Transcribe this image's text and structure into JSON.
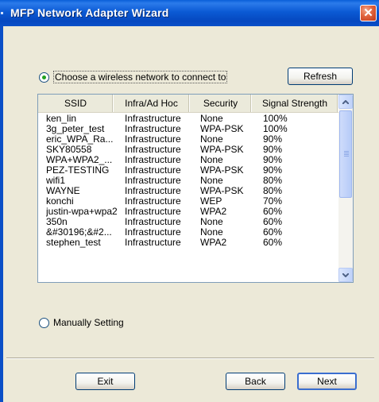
{
  "window": {
    "title": "MFP Network Adapter Wizard"
  },
  "radio_choose": {
    "label": "Choose a wireless network to connect to",
    "checked": true
  },
  "refresh_button": {
    "label": "Refresh"
  },
  "network_list": {
    "columns": [
      "SSID",
      "Infra/Ad Hoc",
      "Security",
      "Signal Strength"
    ],
    "rows": [
      [
        "ken_lin",
        "Infrastructure",
        "None",
        "100%"
      ],
      [
        "3g_peter_test",
        "Infrastructure",
        "WPA-PSK",
        "100%"
      ],
      [
        "eric_WPA_Ra...",
        "Infrastructure",
        "None",
        "90%"
      ],
      [
        "SKY80558",
        "Infrastructure",
        "WPA-PSK",
        "90%"
      ],
      [
        "WPA+WPA2_...",
        "Infrastructure",
        "None",
        "90%"
      ],
      [
        "PEZ-TESTING",
        "Infrastructure",
        "WPA-PSK",
        "90%"
      ],
      [
        "wifi1",
        "Infrastructure",
        "None",
        "80%"
      ],
      [
        "WAYNE",
        "Infrastructure",
        "WPA-PSK",
        "80%"
      ],
      [
        "konchi",
        "Infrastructure",
        "WEP",
        "70%"
      ],
      [
        "justin-wpa+wpa2",
        "Infrastructure",
        "WPA2",
        "60%"
      ],
      [
        "350n",
        "Infrastructure",
        "None",
        "60%"
      ],
      [
        "&#30196;&#2...",
        "Infrastructure",
        "None",
        "60%"
      ],
      [
        "stephen_test",
        "Infrastructure",
        "WPA2",
        "60%"
      ]
    ]
  },
  "radio_manual": {
    "label": "Manually Setting",
    "checked": false
  },
  "footer": {
    "exit_label": "Exit",
    "back_label": "Back",
    "next_label": "Next"
  },
  "colors": {
    "title_bar": "#0b5ad4",
    "close_button": "#e0623c",
    "dialog_bg": "#ece9d8",
    "radio_dot": "#21a121",
    "scrollbar": "#c1d3fb"
  },
  "icons": {
    "close": "close-icon",
    "scroll_up": "chevron-up-icon",
    "scroll_down": "chevron-down-icon"
  }
}
